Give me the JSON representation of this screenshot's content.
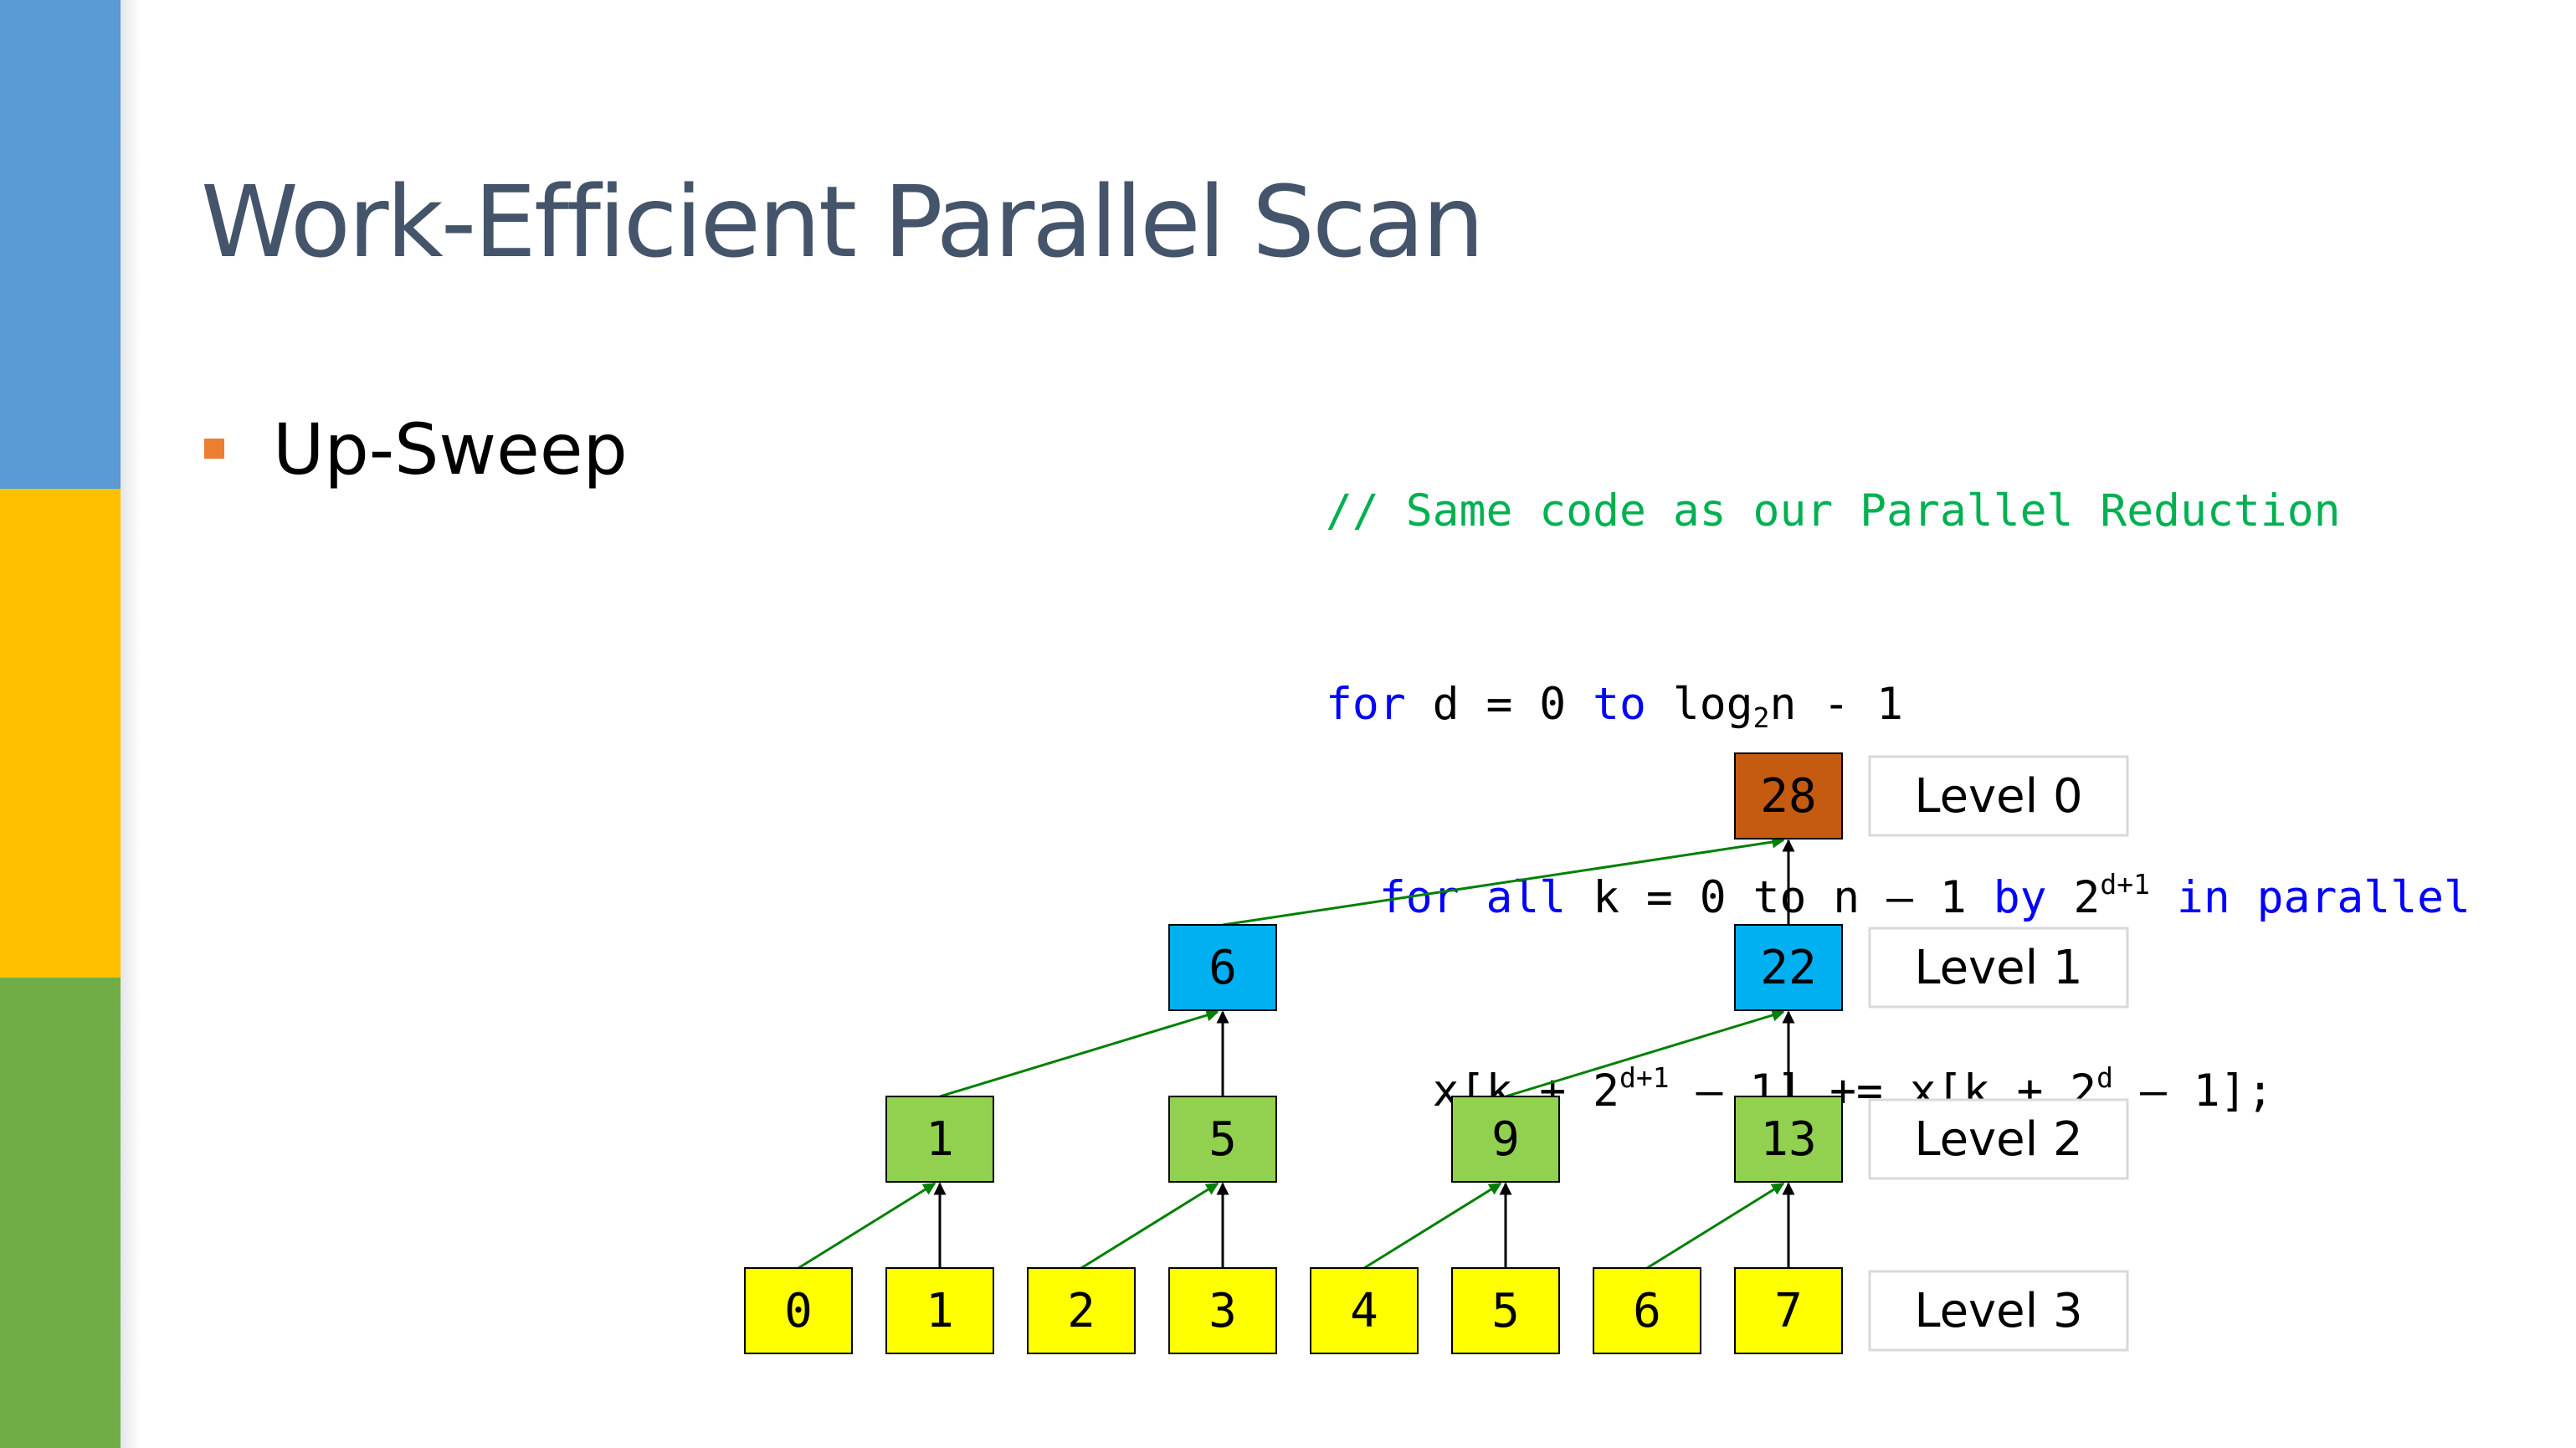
{
  "slide": {
    "title": "Work-Efficient Parallel Scan",
    "bullet": "Up-Sweep"
  },
  "code": {
    "comment": "// Same code as our Parallel Reduction",
    "line1": {
      "for": "for",
      "a": " d = 0 ",
      "to": "to",
      "b": " log",
      "sub": "2",
      "c": "n - 1"
    },
    "line2": {
      "indent": "  ",
      "forall": "for all",
      "a": " k = 0 to n – 1 ",
      "by": "by",
      "b": " 2",
      "sup": "d+1",
      "c": " ",
      "inpar": "in parallel"
    },
    "line3": {
      "indent": "    ",
      "a": "x[k + 2",
      "sup1": "d+1",
      "b": " – 1] += x[k + 2",
      "sup2": "d",
      "c": " – 1];"
    }
  },
  "colors": {
    "level0": "#c55a11",
    "level1": "#00b0f0",
    "level2": "#92d050",
    "level3": "#ffff00",
    "green_arrow": "#008000",
    "black_arrow": "#000000",
    "label_border": "#d9d9d9"
  },
  "tree": {
    "level0": [
      "28"
    ],
    "level1": [
      "6",
      "22"
    ],
    "level2": [
      "1",
      "5",
      "9",
      "13"
    ],
    "level3": [
      "0",
      "1",
      "2",
      "3",
      "4",
      "5",
      "6",
      "7"
    ]
  },
  "levels": [
    "Level 0",
    "Level 1",
    "Level 2",
    "Level 3"
  ]
}
